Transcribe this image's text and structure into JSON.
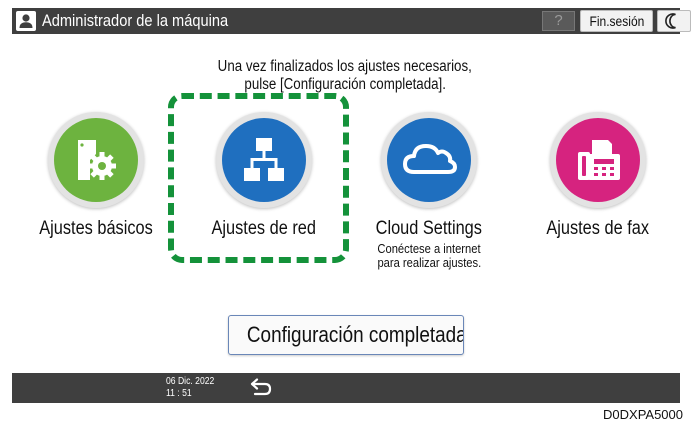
{
  "header": {
    "title": "Administrador de la máquina",
    "help_label": "?",
    "logout_label": "Fin.sesión"
  },
  "instruction": {
    "line1": "Una vez finalizados los ajustes necesarios,",
    "line2": "pulse [Configuración completada]."
  },
  "tiles": [
    {
      "label": "Ajustes básicos",
      "icon": "basic-settings-icon",
      "color": "#6db33f"
    },
    {
      "label": "Ajustes de red",
      "icon": "network-icon",
      "color": "#1f6fbf"
    },
    {
      "label": "Cloud Settings",
      "sub1": "Conéctese a internet",
      "sub2": "para realizar ajustes.",
      "icon": "cloud-icon",
      "color": "#1f6fbf"
    },
    {
      "label": "Ajustes de fax",
      "icon": "fax-icon",
      "color": "#d6237f"
    }
  ],
  "complete_button": {
    "label": "Configuración completada"
  },
  "footer": {
    "date": "06 Dic. 2022",
    "time": "11 : 51"
  },
  "doc_code": "D0DXPA5000",
  "colors": {
    "bar": "#3f3f3f",
    "highlight": "#14923a",
    "blue": "#1f6fbf",
    "green": "#6db33f",
    "magenta": "#d6237f"
  }
}
